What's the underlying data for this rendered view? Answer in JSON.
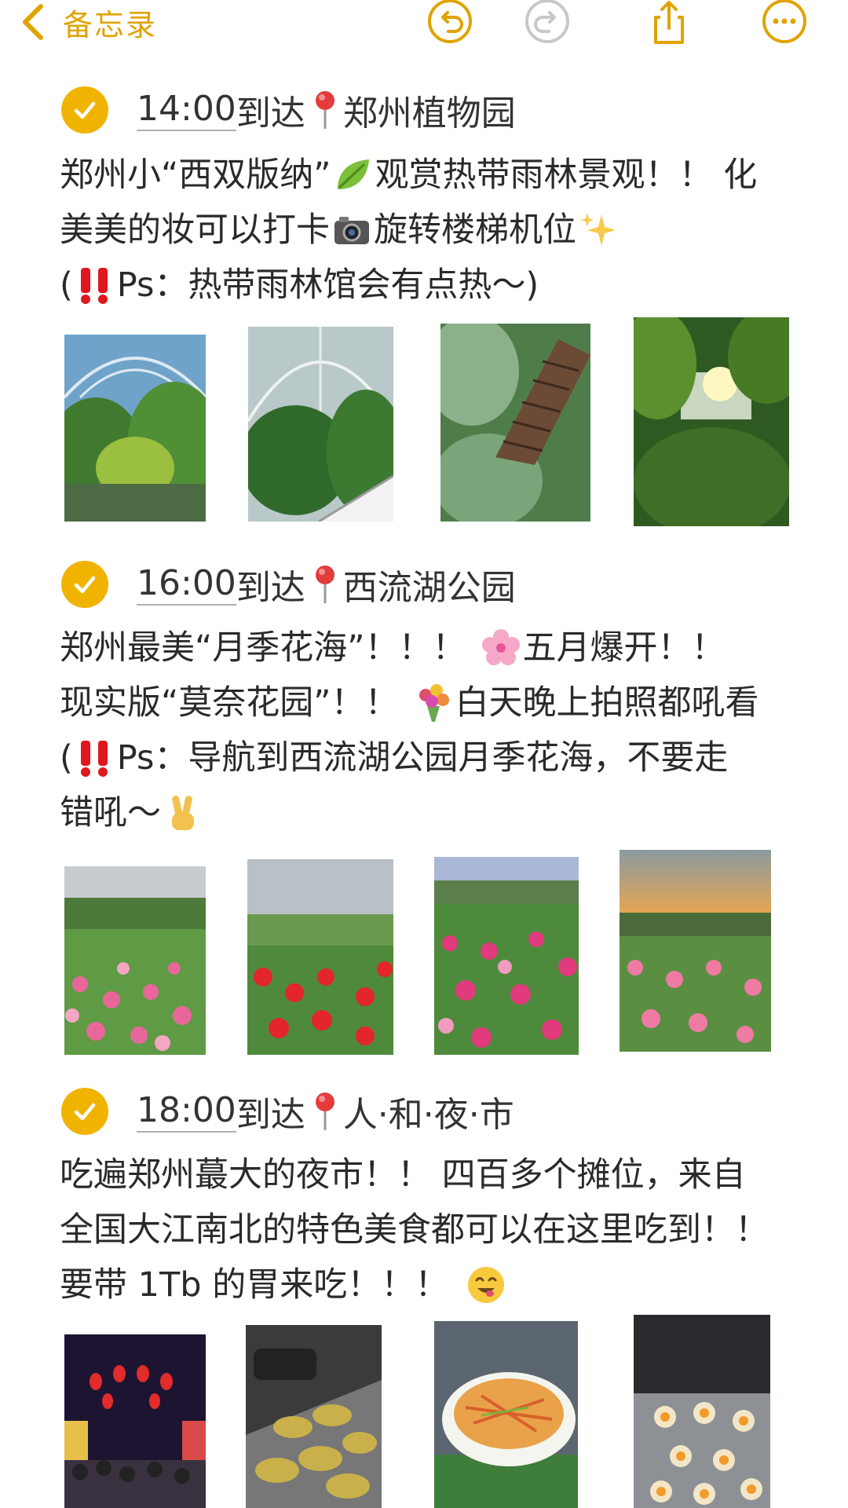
{
  "nav": {
    "back_label": "备忘录",
    "icons": [
      "chevron-left-icon",
      "undo-icon",
      "redo-icon",
      "share-icon",
      "more-icon"
    ],
    "accent_color": "#F0B400"
  },
  "sections": [
    {
      "time": "14:00",
      "arrive": "到达",
      "place": "郑州植物园",
      "lines": [
        {
          "a": "郑州小“西双版纳”",
          "b": "观赏热带雨林景观！！ 化"
        },
        {
          "a": "美美的妆可以打卡",
          "b": "旋转楼梯机位"
        },
        {
          "a": "(",
          "b": "Ps：热带雨林馆会有点热～)"
        }
      ],
      "emoji": [
        "leaf-icon",
        "camera-icon",
        "sparkles-icon",
        "double-exclamation-icon"
      ],
      "photos": [
        "greenhouse-dome-photo",
        "greenhouse-stairs-photo",
        "wooden-stairs-photo",
        "sunlit-leaves-photo"
      ]
    },
    {
      "time": "16:00",
      "arrive": "到达",
      "place": "西流湖公园",
      "lines": [
        {
          "a": "郑州最美“月季花海”！！！",
          "b": "五月爆开！！"
        },
        {
          "a": "现实版“莫奈花园”！！",
          "b": "白天晚上拍照都吼看"
        },
        {
          "a": "(",
          "b": "Ps：导航到西流湖公园月季花海，不要走"
        },
        {
          "a": "错吼～",
          "b": ""
        }
      ],
      "emoji": [
        "cherry-blossom-icon",
        "bouquet-icon",
        "double-exclamation-icon",
        "victory-hand-icon"
      ],
      "photos": [
        "rose-garden-photo-1",
        "rose-garden-photo-2",
        "rose-garden-photo-3",
        "rose-garden-sunset-photo"
      ]
    },
    {
      "time": "18:00",
      "arrive": "到达",
      "place": "人·和·夜·市",
      "lines": [
        {
          "a": "吃遍郑州蕞大的夜市！！ 四百多个摊位，来自",
          "b": ""
        },
        {
          "a": "全国大江南北的特色美食都可以在这里吃到！！",
          "b": ""
        },
        {
          "a": "要带 1Tb 的胃来吃！！！",
          "b": ""
        }
      ],
      "emoji": [
        "yum-face-icon"
      ],
      "photos": [
        "night-market-lanterns-photo",
        "griddle-pancakes-photo",
        "noodle-bowl-photo",
        "fried-eggs-griddle-photo"
      ]
    }
  ]
}
